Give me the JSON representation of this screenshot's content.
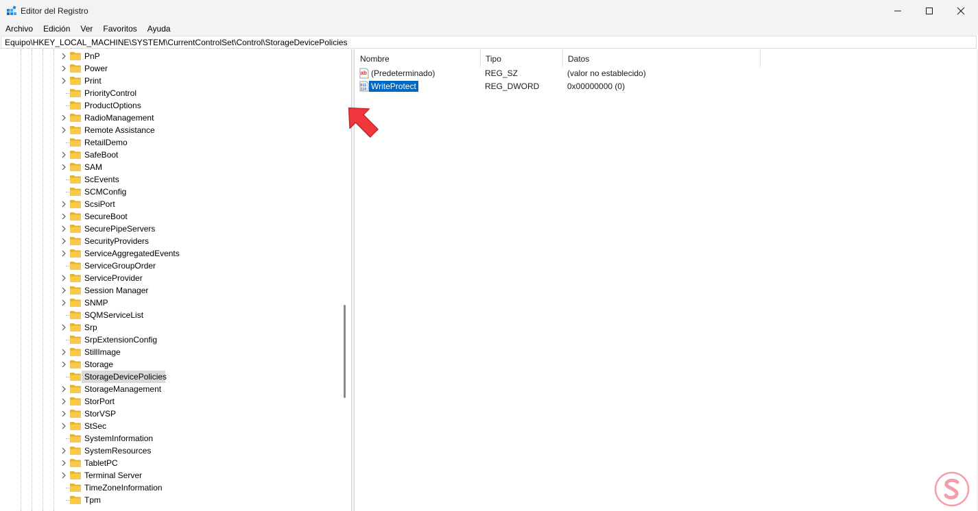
{
  "window": {
    "title": "Editor del Registro",
    "controls": [
      "minimize",
      "maximize",
      "close"
    ]
  },
  "menu": {
    "items": [
      "Archivo",
      "Edición",
      "Ver",
      "Favoritos",
      "Ayuda"
    ]
  },
  "address": {
    "path": "Equipo\\HKEY_LOCAL_MACHINE\\SYSTEM\\CurrentControlSet\\Control\\StorageDevicePolicies"
  },
  "tree": {
    "items": [
      {
        "label": "PnP",
        "expandable": true
      },
      {
        "label": "Power",
        "expandable": true
      },
      {
        "label": "Print",
        "expandable": true
      },
      {
        "label": "PriorityControl",
        "expandable": false
      },
      {
        "label": "ProductOptions",
        "expandable": false
      },
      {
        "label": "RadioManagement",
        "expandable": true
      },
      {
        "label": "Remote Assistance",
        "expandable": true
      },
      {
        "label": "RetailDemo",
        "expandable": false
      },
      {
        "label": "SafeBoot",
        "expandable": true
      },
      {
        "label": "SAM",
        "expandable": true
      },
      {
        "label": "ScEvents",
        "expandable": false
      },
      {
        "label": "SCMConfig",
        "expandable": false
      },
      {
        "label": "ScsiPort",
        "expandable": true
      },
      {
        "label": "SecureBoot",
        "expandable": true
      },
      {
        "label": "SecurePipeServers",
        "expandable": true
      },
      {
        "label": "SecurityProviders",
        "expandable": true
      },
      {
        "label": "ServiceAggregatedEvents",
        "expandable": true
      },
      {
        "label": "ServiceGroupOrder",
        "expandable": false
      },
      {
        "label": "ServiceProvider",
        "expandable": true
      },
      {
        "label": "Session Manager",
        "expandable": true
      },
      {
        "label": "SNMP",
        "expandable": true
      },
      {
        "label": "SQMServiceList",
        "expandable": false
      },
      {
        "label": "Srp",
        "expandable": true
      },
      {
        "label": "SrpExtensionConfig",
        "expandable": false
      },
      {
        "label": "StillImage",
        "expandable": true
      },
      {
        "label": "Storage",
        "expandable": true
      },
      {
        "label": "StorageDevicePolicies",
        "expandable": false,
        "selected": true
      },
      {
        "label": "StorageManagement",
        "expandable": true
      },
      {
        "label": "StorPort",
        "expandable": true
      },
      {
        "label": "StorVSP",
        "expandable": true
      },
      {
        "label": "StSec",
        "expandable": true
      },
      {
        "label": "SystemInformation",
        "expandable": false
      },
      {
        "label": "SystemResources",
        "expandable": true
      },
      {
        "label": "TabletPC",
        "expandable": true
      },
      {
        "label": "Terminal Server",
        "expandable": true
      },
      {
        "label": "TimeZoneInformation",
        "expandable": false
      },
      {
        "label": "Tpm",
        "expandable": false
      }
    ]
  },
  "list": {
    "columns": [
      "Nombre",
      "Tipo",
      "Datos"
    ],
    "rows": [
      {
        "name": "(Predeterminado)",
        "type": "REG_SZ",
        "data": "(valor no establecido)",
        "icon": "string-value-icon"
      },
      {
        "name": "WriteProtect",
        "type": "REG_DWORD",
        "data": "0x00000000 (0)",
        "icon": "binary-value-icon",
        "selected": true
      }
    ]
  },
  "colors": {
    "accent": "#0067c0",
    "folder": "#f8c94a",
    "arrow": "#f0373d",
    "watermark": "#e94e60"
  },
  "watermark_icon": "solvetic-logo"
}
